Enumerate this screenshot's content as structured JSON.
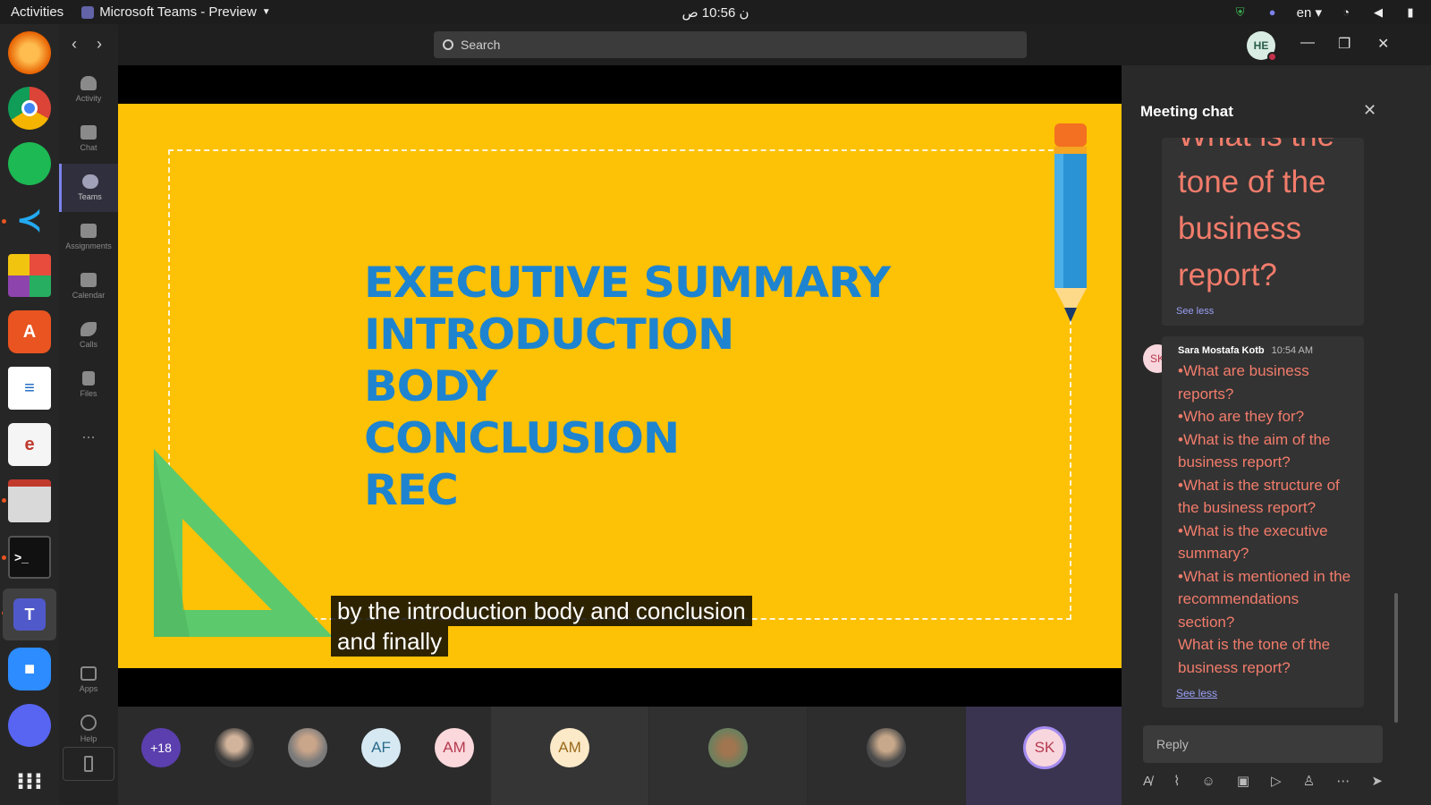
{
  "system": {
    "activities": "Activities",
    "app_title": "Microsoft Teams - Preview",
    "clock": "ن 10:56 ص",
    "language": "en"
  },
  "dock": {
    "apps": [
      "firefox-icon",
      "chrome-icon",
      "spotify-icon",
      "vscode-icon",
      "app-grid-color-icon",
      "software-store-icon",
      "writer-icon",
      "pdf-viewer-icon",
      "files-icon",
      "terminal-icon",
      "teams-icon",
      "zoom-icon",
      "discord-icon",
      "show-apps-icon"
    ]
  },
  "rail": {
    "items": [
      {
        "label": "Activity",
        "icon": "bell-icon"
      },
      {
        "label": "Chat",
        "icon": "chat-icon"
      },
      {
        "label": "Teams",
        "icon": "teams-icon"
      },
      {
        "label": "Assignments",
        "icon": "assignments-icon"
      },
      {
        "label": "Calendar",
        "icon": "calendar-icon"
      },
      {
        "label": "Calls",
        "icon": "phone-icon"
      },
      {
        "label": "Files",
        "icon": "file-icon"
      }
    ],
    "more": "...",
    "apps": "Apps",
    "help": "Help"
  },
  "header": {
    "search_placeholder": "Search",
    "user_initials": "HE"
  },
  "slide": {
    "lines": [
      "EXECUTIVE SUMMARY",
      "INTRODUCTION",
      "BODY",
      "CONCLUSION",
      "REC"
    ],
    "caption_line1": "by the introduction body and conclusion",
    "caption_line2": "and finally"
  },
  "participants": {
    "overflow": "+18",
    "tiles": [
      "AF",
      "AM",
      "AM",
      "SK"
    ]
  },
  "chat": {
    "title": "Meeting chat",
    "msg1_text": "What is the tone of the business report?",
    "see_less": "See less",
    "msg2": {
      "initials": "SK",
      "sender": "Sara Mostafa Kotb",
      "time": "10:54 AM",
      "questions": [
        "•What are business reports?",
        "•Who are they for?",
        "•What is the aim of the business report?",
        "•What is the structure of the business report?",
        "•What is the executive summary?",
        "•What is mentioned in the recommendations section?",
        "What is the tone of the business report?"
      ],
      "see_less": "See less"
    },
    "reply_placeholder": "Reply"
  },
  "colors": {
    "slide_bg": "#fdc106",
    "slide_text": "#1e84d0",
    "chat_text": "#f27c6b",
    "accent": "#7b83eb"
  }
}
